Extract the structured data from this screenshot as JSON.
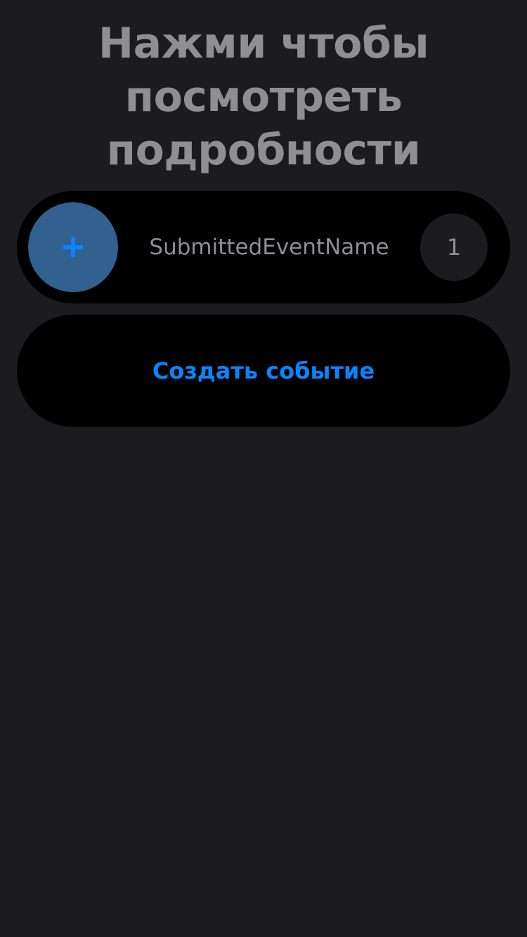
{
  "header": {
    "title": "Нажми чтобы\nпосмотреть\nподробности"
  },
  "event": {
    "add_icon": "plus-icon",
    "name": "SubmittedEventName",
    "count": "1"
  },
  "actions": {
    "create_label": "Создать событие"
  },
  "colors": {
    "background": "#1c1c1e",
    "card": "#000000",
    "accent": "#0a84ff",
    "add_circle": "#32608f",
    "secondary_text": "#8e8e93"
  }
}
